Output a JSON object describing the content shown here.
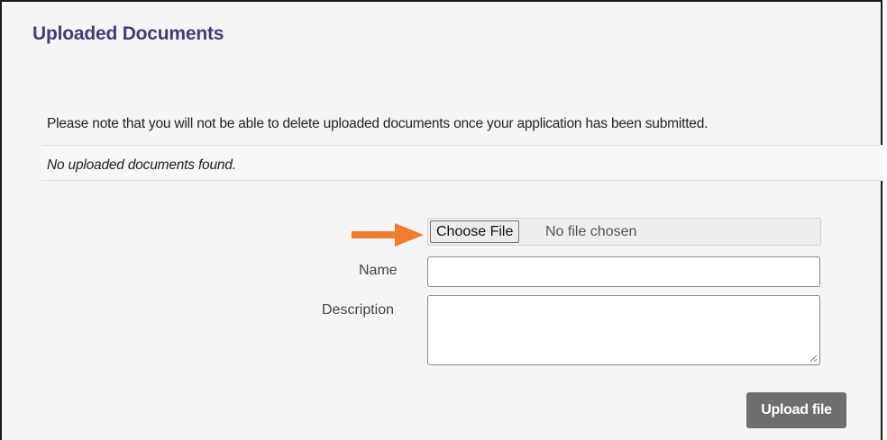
{
  "section": {
    "title": "Uploaded Documents",
    "note": "Please note that you will not be able to delete uploaded documents once your application has been submitted.",
    "empty_message": "No uploaded documents found."
  },
  "form": {
    "choose_file_label": "Choose File",
    "file_status": "No file chosen",
    "name_label": "Name",
    "name_value": "",
    "description_label": "Description",
    "description_value": "",
    "upload_label": "Upload file"
  },
  "colors": {
    "title": "#3c3e78",
    "arrow": "#ef7d2d",
    "upload_button": "#6e6e6e"
  },
  "icons": {
    "arrow": "arrow-right-icon",
    "resize": "resize-grip-icon"
  }
}
